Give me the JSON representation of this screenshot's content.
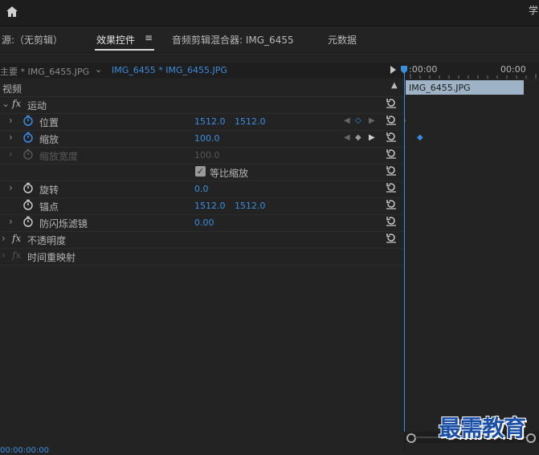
{
  "topbar": {
    "home_icon": "home-icon",
    "right_text": "学"
  },
  "tabs": [
    {
      "label": "源:（无剪辑）"
    },
    {
      "label": "效果控件"
    },
    {
      "label": "音频剪辑混合器: IMG_6455"
    },
    {
      "label": "元数据"
    }
  ],
  "clip_header": {
    "master": "主要 * IMG_6455.JPG",
    "sequence": "IMG_6455 * IMG_6455.JPG"
  },
  "timeline": {
    "start_time": ":00:00",
    "end_time": "00:00",
    "clip_name": "IMG_6455.JPG",
    "bottom_time": "00:00:00:00"
  },
  "rows": {
    "video": "视频",
    "motion": "运动",
    "position": {
      "label": "位置",
      "x": "1512.0",
      "y": "1512.0"
    },
    "scale": {
      "label": "缩放",
      "value": "100.0"
    },
    "scale_width": {
      "label": "缩放宽度",
      "value": "100.0"
    },
    "uniform_scale": {
      "label": "等比缩放",
      "checked": true
    },
    "rotation": {
      "label": "旋转",
      "value": "0.0"
    },
    "anchor": {
      "label": "锚点",
      "x": "1512.0",
      "y": "1512.0"
    },
    "anti_flicker": {
      "label": "防闪烁滤镜",
      "value": "0.00"
    },
    "opacity": "不透明度",
    "time_remap": "时间重映射"
  },
  "watermark": "最需教育",
  "colors": {
    "accent": "#3b8de0",
    "panel": "#232323",
    "clipbar": "#9fb3c6"
  }
}
